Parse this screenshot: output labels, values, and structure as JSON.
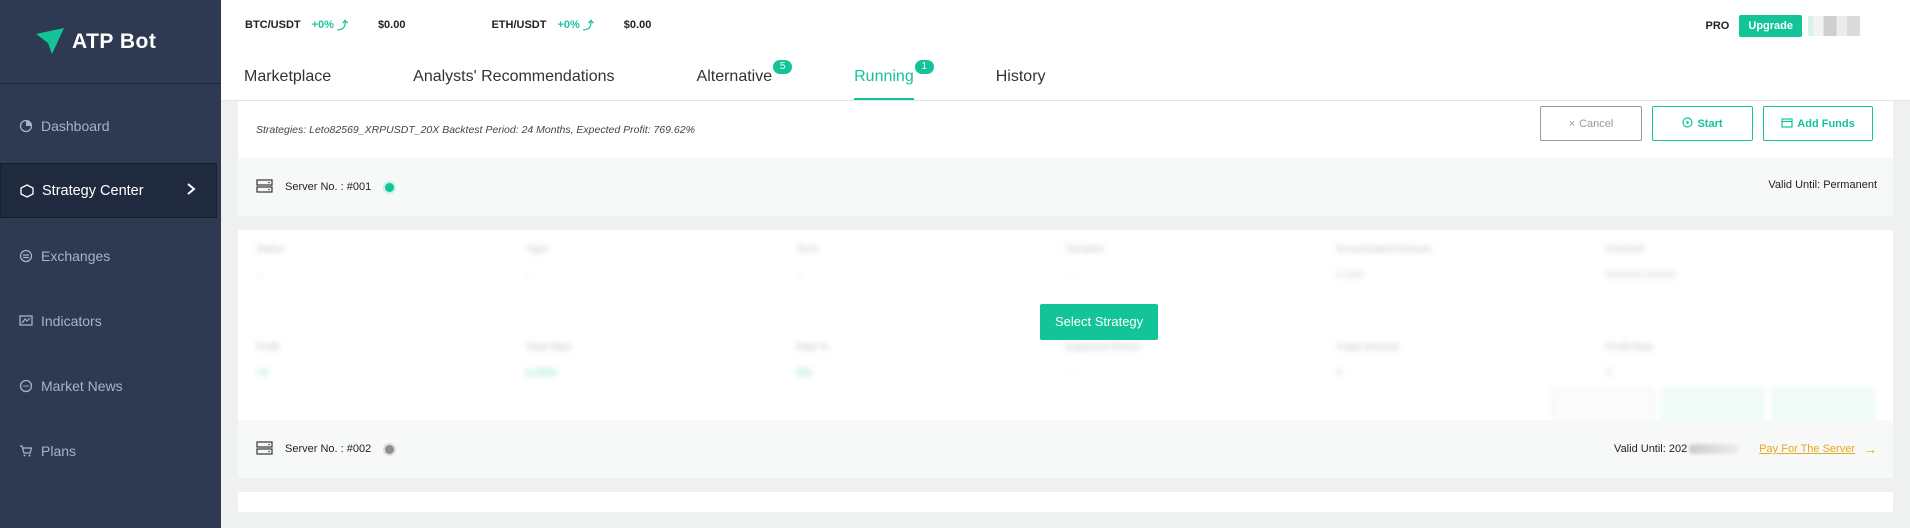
{
  "app": {
    "name": "ATP Bot",
    "colors": {
      "accent": "#12c497",
      "sidebar": "#2d3a52",
      "link": "#e6a820"
    }
  },
  "sidebar": {
    "items": [
      {
        "label": "Dashboard",
        "icon": "dashboard-icon",
        "active": false
      },
      {
        "label": "Strategy Center",
        "icon": "cube-icon",
        "active": true
      },
      {
        "label": "Exchanges",
        "icon": "exchange-icon",
        "active": false
      },
      {
        "label": "Indicators",
        "icon": "indicator-icon",
        "active": false
      },
      {
        "label": "Market News",
        "icon": "news-icon",
        "active": false
      },
      {
        "label": "Plans",
        "icon": "cart-icon",
        "active": false
      }
    ]
  },
  "topbar": {
    "tickers": [
      {
        "pair": "BTC/USDT",
        "change": "+0%",
        "price": "$0.00"
      },
      {
        "pair": "ETH/USDT",
        "change": "+0%",
        "price": "$0.00"
      }
    ],
    "pro": "PRO",
    "upgrade": "Upgrade"
  },
  "tabs": [
    {
      "label": "Marketplace"
    },
    {
      "label": "Analysts' Recommendations"
    },
    {
      "label": "Alternative",
      "badge": "5"
    },
    {
      "label": "Running",
      "badge": "1",
      "active": true
    },
    {
      "label": "History"
    }
  ],
  "card1": {
    "strategy_line": "Strategies: Leto82569_XRPUSDT_20X   Backtest Period: 24 Months, Expected Profit: 769.62%",
    "cancel": "Cancel",
    "start": "Start",
    "add_funds": "Add Funds",
    "server_label": "Server No. : #001",
    "valid_until": "Valid Until: Permanent"
  },
  "card2": {
    "select_strategy": "Select Strategy",
    "server_label": "Server No. : #002",
    "valid_until": "Valid Until: 202",
    "pay_link": "Pay For The Server",
    "blurred_labels": [
      "Status",
      "Type",
      "Term",
      "Duration",
      "Accumulated Amount",
      "Invested",
      "Profit",
      "Total Rate",
      "Rate %",
      "Expected Return",
      "Trade Amount",
      "Profit Rate"
    ],
    "blurred_values": [
      "--",
      "--",
      "--",
      "--",
      "0.000",
      "000000.00000",
      "+0",
      "0.00%",
      "0%",
      "--",
      "0",
      "0"
    ]
  }
}
